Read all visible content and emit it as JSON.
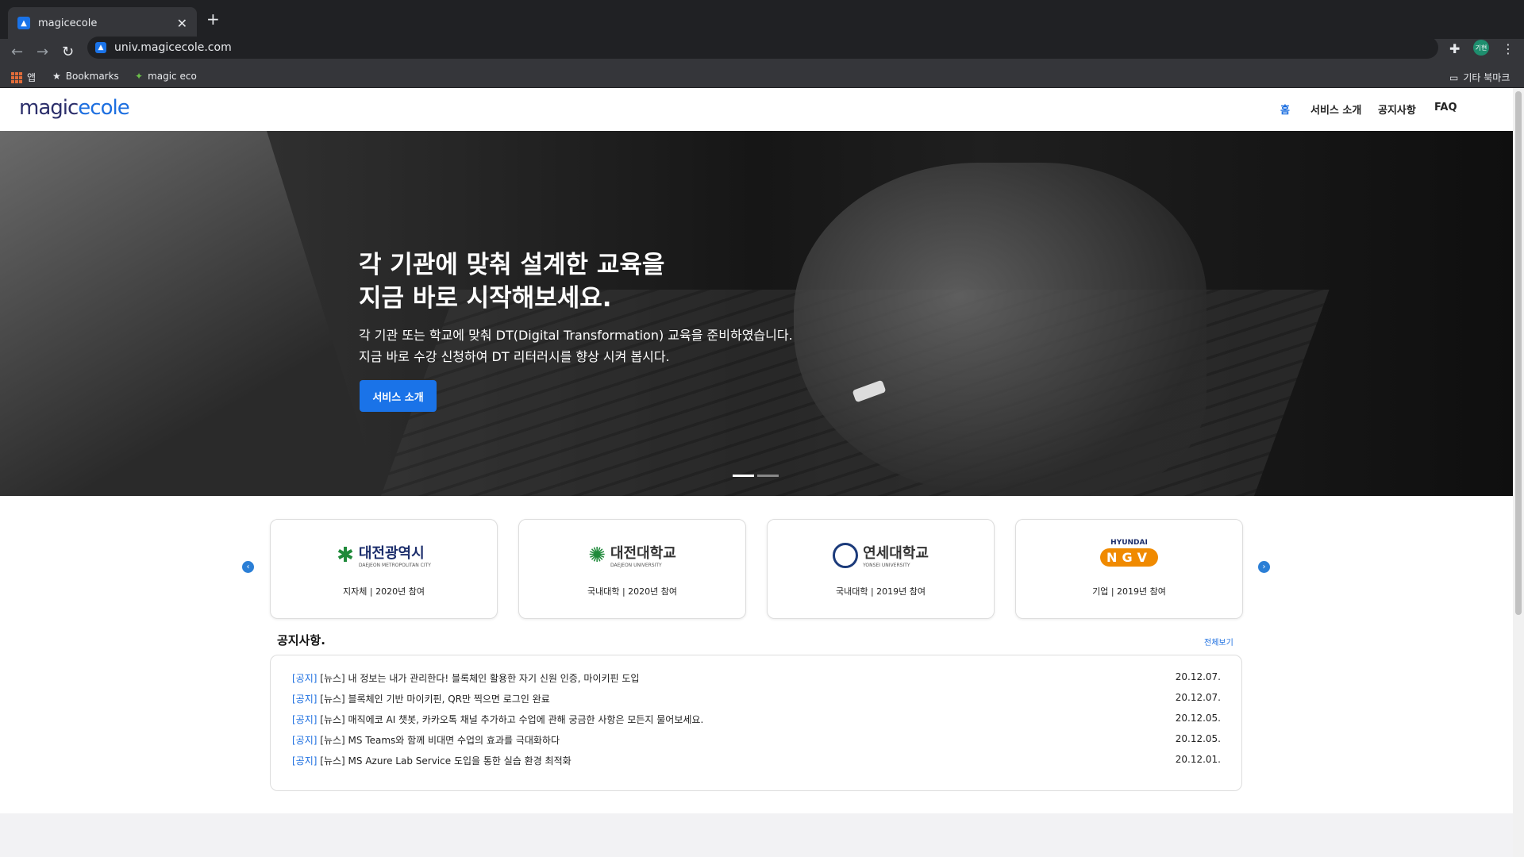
{
  "browser": {
    "tab_title": "magicecole",
    "tab_close": "✕",
    "new_tab": "+",
    "url": "univ.magicecole.com",
    "profile": "기현",
    "bookmarks": [
      {
        "label": "앱"
      },
      {
        "label": "Bookmarks"
      },
      {
        "label": "magic eco"
      }
    ],
    "other_bookmarks": "기타 북마크"
  },
  "header": {
    "logo_a": "magic",
    "logo_b": "ecole",
    "nav": [
      "홈",
      "서비스 소개",
      "공지사항",
      "FAQ"
    ]
  },
  "hero": {
    "title_line1": "각 기관에 맞춰 설계한 교육을",
    "title_line2": "지금 바로 시작해보세요.",
    "desc_line1": "각 기관 또는 학교에 맞춰 DT(Digital Transformation) 교육을 준비하였습니다.",
    "desc_line2": "지금 바로 수강 신청하여 DT 리터러시를 향상 시켜 봅시다.",
    "button": "서비스 소개"
  },
  "partners": [
    {
      "name": "대전광역시",
      "sub": "DAEJEON METROPOLITAN CITY",
      "caption": "지자체 | 2020년 참여",
      "color": "#1f8a3a"
    },
    {
      "name": "대전대학교",
      "sub": "DAEJEON UNIVERSITY",
      "caption": "국내대학 | 2020년 참여",
      "color": "#1f8a3a"
    },
    {
      "name": "연세대학교",
      "sub": "YONSEI UNIVERSITY",
      "caption": "국내대학 | 2019년 참여",
      "color": "#1b3a7a"
    },
    {
      "name": "NGV",
      "sub": "HYUNDAI",
      "caption": "기업 | 2019년 참여",
      "color": "#f08a00"
    }
  ],
  "notice": {
    "title": "공지사항.",
    "see_all": "전체보기",
    "items": [
      {
        "tag": "[공지]",
        "text": "[뉴스] 내 정보는 내가 관리한다! 블록체인 활용한 자기 신원 인증, 마이키핀 도입",
        "date": "20.12.07."
      },
      {
        "tag": "[공지]",
        "text": "[뉴스] 블록체인 기반 마이키핀, QR만 찍으면 로그인 완료",
        "date": "20.12.07."
      },
      {
        "tag": "[공지]",
        "text": "[뉴스] 매직에코 AI 챗봇, 카카오톡 채널 추가하고 수업에 관해 궁금한 사항은 모든지 물어보세요.",
        "date": "20.12.05."
      },
      {
        "tag": "[공지]",
        "text": "[뉴스] MS Teams와 함께 비대면 수업의 효과를 극대화하다",
        "date": "20.12.05."
      },
      {
        "tag": "[공지]",
        "text": "[뉴스] MS Azure Lab Service 도입을 통한 실습 환경 최적화",
        "date": "20.12.01."
      }
    ]
  }
}
